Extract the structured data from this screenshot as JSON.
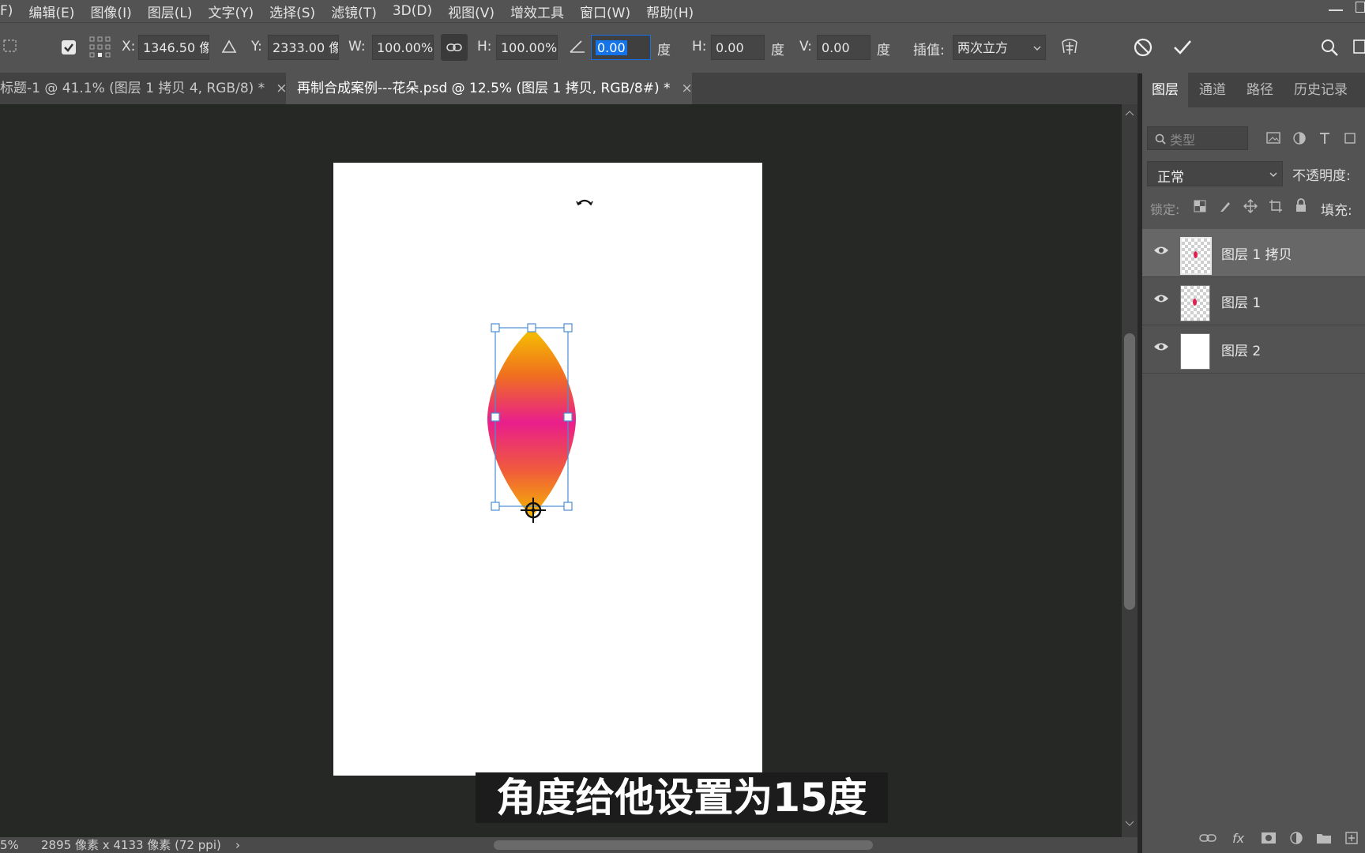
{
  "menu": [
    "F)",
    "编辑(E)",
    "图像(I)",
    "图层(L)",
    "文字(Y)",
    "选择(S)",
    "滤镜(T)",
    "3D(D)",
    "视图(V)",
    "增效工具",
    "窗口(W)",
    "帮助(H)"
  ],
  "options": {
    "x_label": "X:",
    "x_value": "1346.50 像",
    "y_label": "Y:",
    "y_value": "2333.00 像",
    "w_label": "W:",
    "w_value": "100.00%",
    "h_label": "H:",
    "h_value": "100.00%",
    "angle_value": "0.00",
    "deg1": "度",
    "hskew_label": "H:",
    "hskew_value": "0.00",
    "deg2": "度",
    "vskew_label": "V:",
    "vskew_value": "0.00",
    "deg3": "度",
    "interp_label": "插值:",
    "interp_value": "两次立方"
  },
  "tabs": [
    {
      "label": "标题-1 @ 41.1% (图层 1 拷贝 4, RGB/8) *",
      "close": "×"
    },
    {
      "label": "再制合成案例---花朵.psd @ 12.5% (图层 1 拷贝, RGB/8#) *",
      "close": "×"
    }
  ],
  "panel": {
    "tabs": [
      "图层",
      "通道",
      "路径",
      "历史记录"
    ],
    "search_placeholder": "类型",
    "blend_mode": "正常",
    "opacity_label": "不透明度:",
    "lock_label": "锁定:",
    "fill_label": "填充:",
    "layers": [
      {
        "name": "图层 1 拷贝",
        "selected": true
      },
      {
        "name": "图层 1",
        "selected": false
      },
      {
        "name": "图层 2",
        "selected": false
      }
    ],
    "footer_fx": "fx"
  },
  "status": {
    "zoom": "5%",
    "doc_size": "2895 像素 x 4133 像素 (72 ppi)",
    "arrow": "›"
  },
  "caption": "角度给他设置为15度",
  "colors": {
    "accent": "#1473e6",
    "gradient_top": "#f5b800",
    "gradient_mid": "#e91e8c"
  }
}
